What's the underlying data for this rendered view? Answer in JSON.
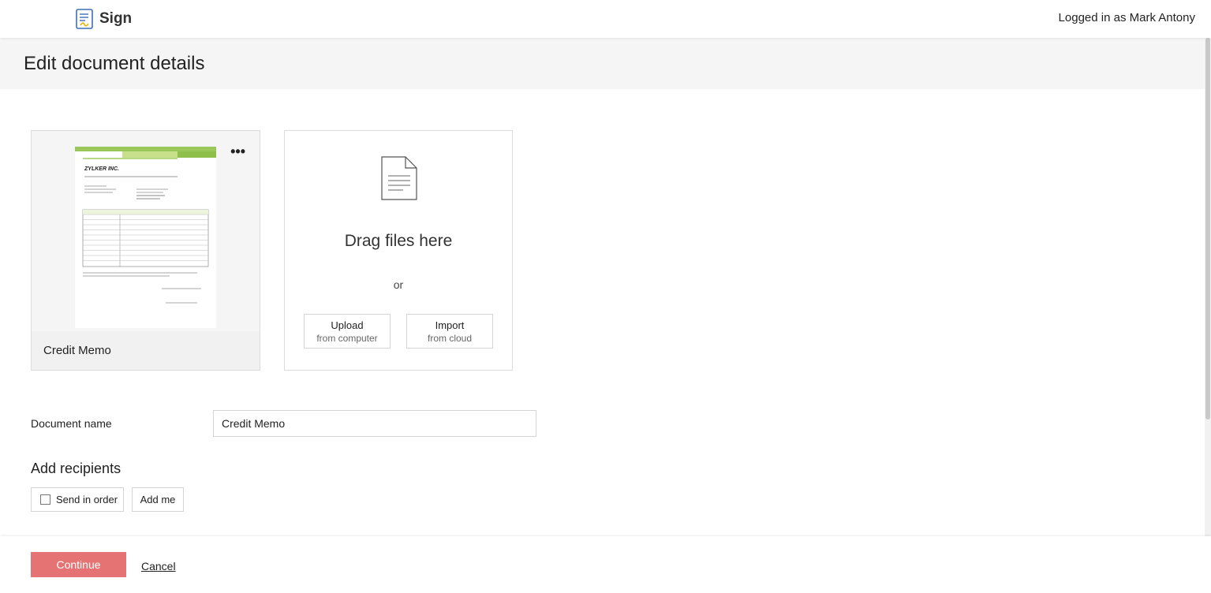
{
  "header": {
    "app_name": "Sign",
    "logged_in_text": "Logged in as Mark Antony"
  },
  "page": {
    "title": "Edit document details"
  },
  "document_card": {
    "name": "Credit Memo",
    "menu_label": "•••"
  },
  "drop_zone": {
    "drag_text": "Drag files here",
    "or_text": "or",
    "upload": {
      "label": "Upload",
      "sublabel": "from computer"
    },
    "import": {
      "label": "Import",
      "sublabel": "from cloud"
    }
  },
  "form": {
    "document_name_label": "Document name",
    "document_name_value": "Credit Memo"
  },
  "recipients": {
    "title": "Add recipients",
    "send_in_order_label": "Send in order",
    "add_me_label": "Add me"
  },
  "footer": {
    "continue_label": "Continue",
    "cancel_label": "Cancel"
  },
  "colors": {
    "accent": "#e57373",
    "header_band": "#f5f5f5"
  }
}
